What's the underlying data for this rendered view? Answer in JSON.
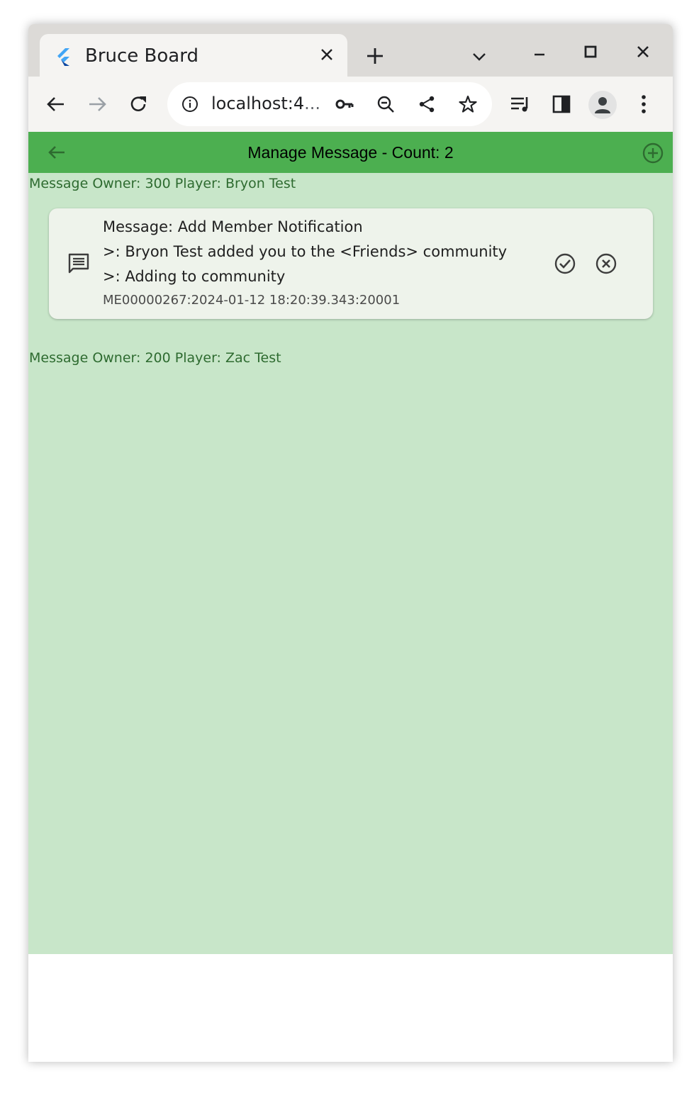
{
  "browser": {
    "tab_title": "Bruce Board",
    "url_main": "localhost:4",
    "url_ellipsis": "...",
    "icons": [
      "flutter-favicon-icon",
      "close-icon",
      "plus-icon",
      "chevron-down-icon",
      "minimize-icon",
      "maximize-icon",
      "close-icon",
      "back-arrow-icon",
      "forward-arrow-icon",
      "reload-icon",
      "info-icon",
      "key-icon",
      "zoom-out-icon",
      "share-icon",
      "star-icon",
      "media-queue-icon",
      "side-panel-icon",
      "profile-icon",
      "kebab-menu-icon"
    ]
  },
  "app": {
    "title": "Manage Message - Count: 2",
    "colors": {
      "appbar": "#4caf50",
      "background": "#c8e6c9",
      "owner_text": "#2e6b30"
    },
    "groups": [
      {
        "owner_label": "Message Owner: 300 Player: Bryon Test",
        "messages": [
          {
            "line1": "Message: Add Member Notification",
            "line2": ">: Bryon Test added you to the <Friends> community",
            "line3": ">: Adding to community",
            "id": "ME00000267:2024-01-12 18:20:39.343:20001"
          }
        ]
      },
      {
        "owner_label": "Message Owner: 200 Player: Zac Test",
        "messages": []
      }
    ]
  }
}
